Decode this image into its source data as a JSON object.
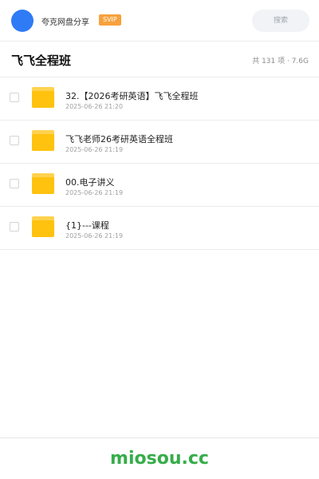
{
  "header": {
    "brand": "夸克网盘分享",
    "badge": "SVIP",
    "search_placeholder": "搜索"
  },
  "folder": {
    "title": "飞飞全程班",
    "meta": "共 131 项 · 7.6G"
  },
  "items": [
    {
      "name": "32.【2026考研英语】飞飞全程班",
      "date": "2025-06-26 21:20"
    },
    {
      "name": "飞飞老师26考研英语全程班",
      "date": "2025-06-26 21:19"
    },
    {
      "name": "00.电子讲义",
      "date": "2025-06-26 21:19"
    },
    {
      "name": "{1}---课程",
      "date": "2025-06-26 21:19"
    }
  ],
  "watermark": "miosou.cc",
  "colors": {
    "avatar": "#2f7bf6",
    "badge": "#f7a13c",
    "folder": "#ffc82c",
    "watermark": "#36ad4a"
  }
}
